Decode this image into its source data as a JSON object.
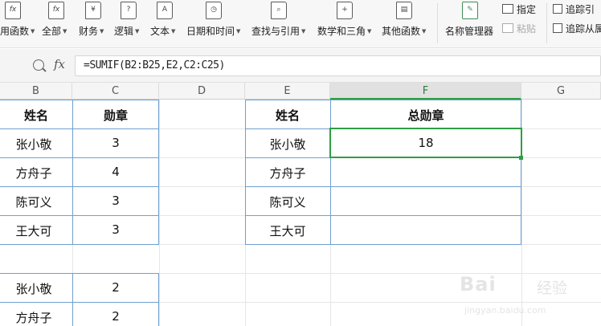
{
  "ribbon": {
    "groups": [
      {
        "label": "用函数",
        "icon": "fx"
      },
      {
        "label": "全部",
        "icon": "fx"
      },
      {
        "label": "财务",
        "icon": "¥"
      },
      {
        "label": "逻辑",
        "icon": "?"
      },
      {
        "label": "文本",
        "icon": "A"
      },
      {
        "label": "日期和时间",
        "icon": "◷"
      },
      {
        "label": "查找与引用",
        "icon": "⌕"
      },
      {
        "label": "数学和三角",
        "icon": "+"
      },
      {
        "label": "其他函数",
        "icon": "▤"
      },
      {
        "label": "名称管理器",
        "icon": "✎"
      }
    ],
    "small": {
      "assign": "指定",
      "paste": "粘贴",
      "trace_precedents": "追踪引",
      "trace_dependents": "追踪从属"
    }
  },
  "formula_bar": {
    "fx_label": "fx",
    "formula": "=SUMIF(B2:B25,E2,C2:C25)"
  },
  "columns": [
    "B",
    "C",
    "D",
    "E",
    "F",
    "G"
  ],
  "selected_column": "F",
  "left_table": {
    "headers": [
      "姓名",
      "勋章"
    ],
    "rows": [
      [
        "张小敬",
        "3"
      ],
      [
        "方舟子",
        "4"
      ],
      [
        "陈可义",
        "3"
      ],
      [
        "王大可",
        "3"
      ],
      [
        "",
        ""
      ],
      [
        "张小敬",
        "2"
      ],
      [
        "方舟子",
        "2"
      ]
    ]
  },
  "right_table": {
    "headers": [
      "姓名",
      "总勋章"
    ],
    "rows": [
      [
        "张小敬",
        "18"
      ],
      [
        "方舟子",
        ""
      ],
      [
        "陈可义",
        ""
      ],
      [
        "王大可",
        ""
      ]
    ]
  },
  "watermark": {
    "logo": "Bai",
    "text": "经验",
    "url": "jingyan.baidu.com"
  }
}
